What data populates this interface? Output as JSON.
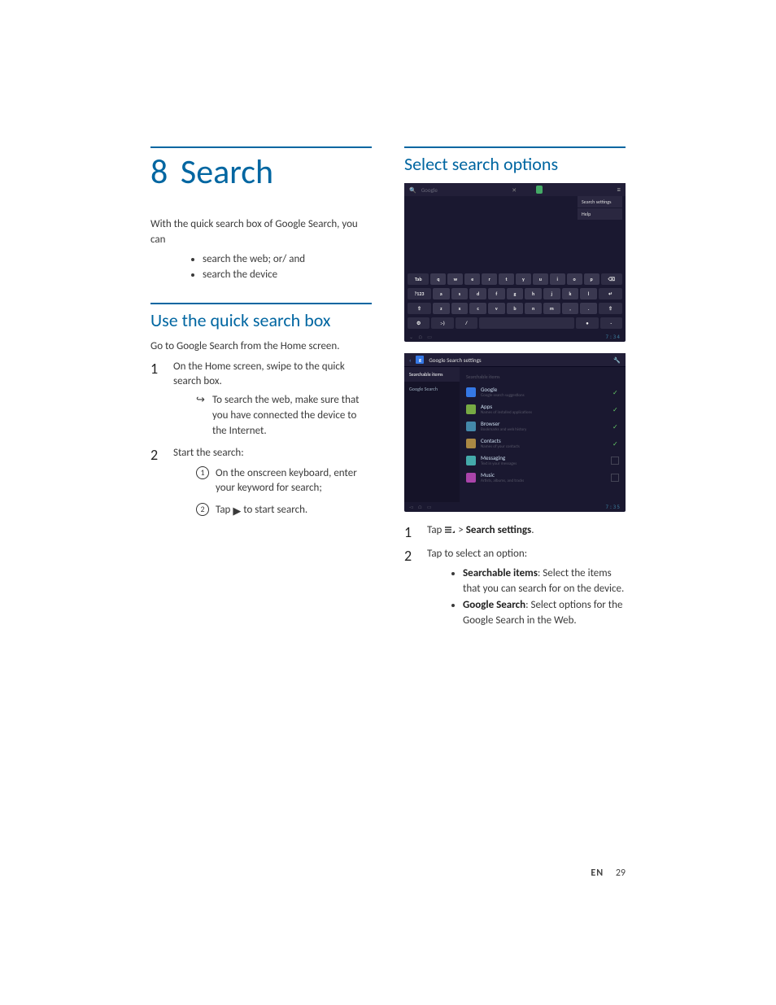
{
  "chapter": {
    "number": "8",
    "title": "Search"
  },
  "intro": {
    "lead": "With the quick search box of Google Search, you can",
    "bullets": [
      "search the web; or/ and",
      "search the device"
    ]
  },
  "section1": {
    "heading": "Use the quick search box",
    "lead": "Go to Google Search from the Home screen.",
    "steps": [
      {
        "text": "On the Home screen, swipe to the quick search box.",
        "arrow_note": "To search the web, make sure that you have connected the device to the Internet."
      },
      {
        "text": "Start the search:",
        "circled": [
          "On the onscreen keyboard, enter your keyword for search;",
          {
            "pre": "Tap ",
            "icon": "▶",
            "post": " to start search."
          }
        ]
      }
    ]
  },
  "section2": {
    "heading": "Select search options",
    "steps": [
      {
        "pre": "Tap ",
        "icon_name": "menu-icon",
        "post_bold": "Search settings",
        "post_plain": ".",
        "sep": " > "
      },
      {
        "text": "Tap to select an option:",
        "bullets": [
          {
            "bold": "Searchable items",
            "rest": ": Select the items that you can search for on the device."
          },
          {
            "bold": "Google Search",
            "rest": ": Select options for the Google Search in the Web."
          }
        ]
      }
    ]
  },
  "screenshot1": {
    "search_hint": "Google",
    "menu": [
      "Search settings",
      "Help"
    ],
    "keyboard": {
      "row1": [
        "Tab",
        "q",
        "w",
        "e",
        "r",
        "t",
        "y",
        "u",
        "i",
        "o",
        "p",
        "⌫"
      ],
      "row2": [
        "?123",
        "a",
        "s",
        "d",
        "f",
        "g",
        "h",
        "j",
        "k",
        "l",
        "↵"
      ],
      "row3": [
        "⇧",
        "z",
        "x",
        "c",
        "v",
        "b",
        "n",
        "m",
        ",",
        ".",
        "⇧"
      ],
      "row4_left": "⚙",
      "row4_lang": ":-)",
      "row4_slash": "/",
      "row4_right1": "•",
      "row4_right2": "-"
    },
    "clock": "7:34"
  },
  "screenshot2": {
    "title": "Google Search settings",
    "sidebar": [
      "Searchable items",
      "Google Search"
    ],
    "list_header": "Searchable items",
    "items": [
      {
        "name": "Google",
        "desc": "Google search suggestions",
        "checked": true,
        "color": "#3578e5"
      },
      {
        "name": "Apps",
        "desc": "Names of installed applications",
        "checked": true,
        "color": "#7a4"
      },
      {
        "name": "Browser",
        "desc": "Bookmarks and web history",
        "checked": true,
        "color": "#48a"
      },
      {
        "name": "Contacts",
        "desc": "Names of your contacts",
        "checked": true,
        "color": "#a84"
      },
      {
        "name": "Messaging",
        "desc": "Text in your messages",
        "checked": false,
        "color": "#4aa"
      },
      {
        "name": "Music",
        "desc": "Artists, albums, and tracks",
        "checked": false,
        "color": "#a4a"
      }
    ],
    "clock": "7:35"
  },
  "footer": {
    "lang": "EN",
    "page": "29"
  }
}
